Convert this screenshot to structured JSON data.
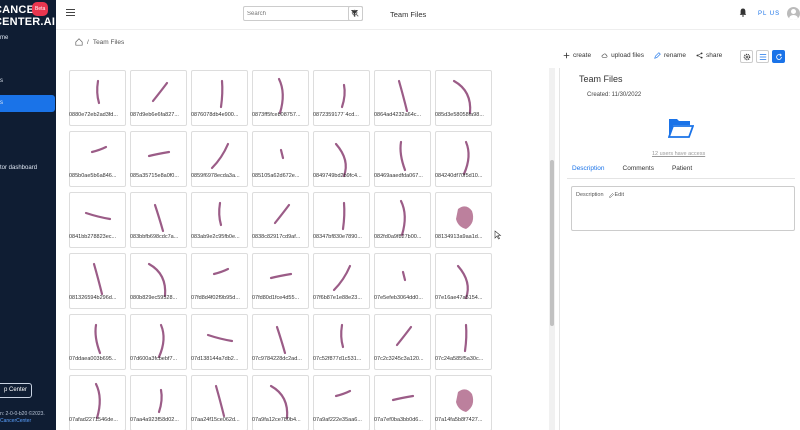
{
  "sidebar": {
    "logo_line1": "CANCER",
    "logo_line2": "CENTER.AI",
    "beta": "Beta",
    "items": [
      {
        "label": "me"
      },
      {
        "label": "s"
      },
      {
        "label": "s"
      },
      {
        "label": "tor dashboard"
      }
    ],
    "help_label": "p Center",
    "footer_line1": "n: 2-0-0-b20 ©2023.",
    "footer_line2": "CancerCenter"
  },
  "topbar": {
    "search_placeholder": "Search",
    "title": "Team Files",
    "lang": "PL US"
  },
  "breadcrumb": {
    "current": "Team Files"
  },
  "toolbar": {
    "create": "create",
    "upload": "upload files",
    "rename": "rename",
    "share": "share"
  },
  "files": [
    "0880e72eb2ad3fd...",
    "087d9eb6e6fa827...",
    "0876078db4e900...",
    "0873ff5fceb08757...",
    "0872359177´4cd...",
    "0864ad4232a64c...",
    "085d3e58058fa98...",
    "085b0ae5b6a846...",
    "085a35715e8a0f0...",
    "0859f6978ecda3a...",
    "085105a62d672e...",
    "0849749bd2b9fc4...",
    "08469aaedfda067...",
    "084240df70f5d10...",
    "0841bb278823ec...",
    "083bbfb698cdc7a...",
    "083ab9e2c95fb0e...",
    "0838c82917cd9af...",
    "08347bf830e7890...",
    "082fd0a9f827b00...",
    "08134913a9aa1d...",
    "081326594b296d...",
    "080b829ec59528...",
    "07fd8d4f02f9b95d...",
    "07fd80d1fce4d55...",
    "07f6b87e1e88e23...",
    "07e5efeb3064dd0...",
    "07e16ae47a5154...",
    "07ddaea003b695...",
    "07d600a3fcbebf7...",
    "07d138144a7db2...",
    "07c9784228dc2ad...",
    "07c52f877d1c531...",
    "07c2c3245c3a120...",
    "07c24a585f5a30c...",
    "07afad2271546de...",
    "07aa4a923f58d02...",
    "07aa24f15ce062d...",
    "07a9fa12ce780b4...",
    "07a9af222e35aa6...",
    "07a7ef0ba3bb0d6...",
    "07a14fa5b8f7427..."
  ],
  "panel": {
    "title": "Team Files",
    "created": "Created: 11/30/2022",
    "users_access": "12 users have access",
    "tabs": [
      "Description",
      "Comments",
      "Patient"
    ],
    "desc_label": "Description",
    "edit_label": "Edit"
  },
  "colors": {
    "sidebar_bg": "#0f1d33",
    "accent": "#1a73e8",
    "beta": "#e8364f"
  }
}
